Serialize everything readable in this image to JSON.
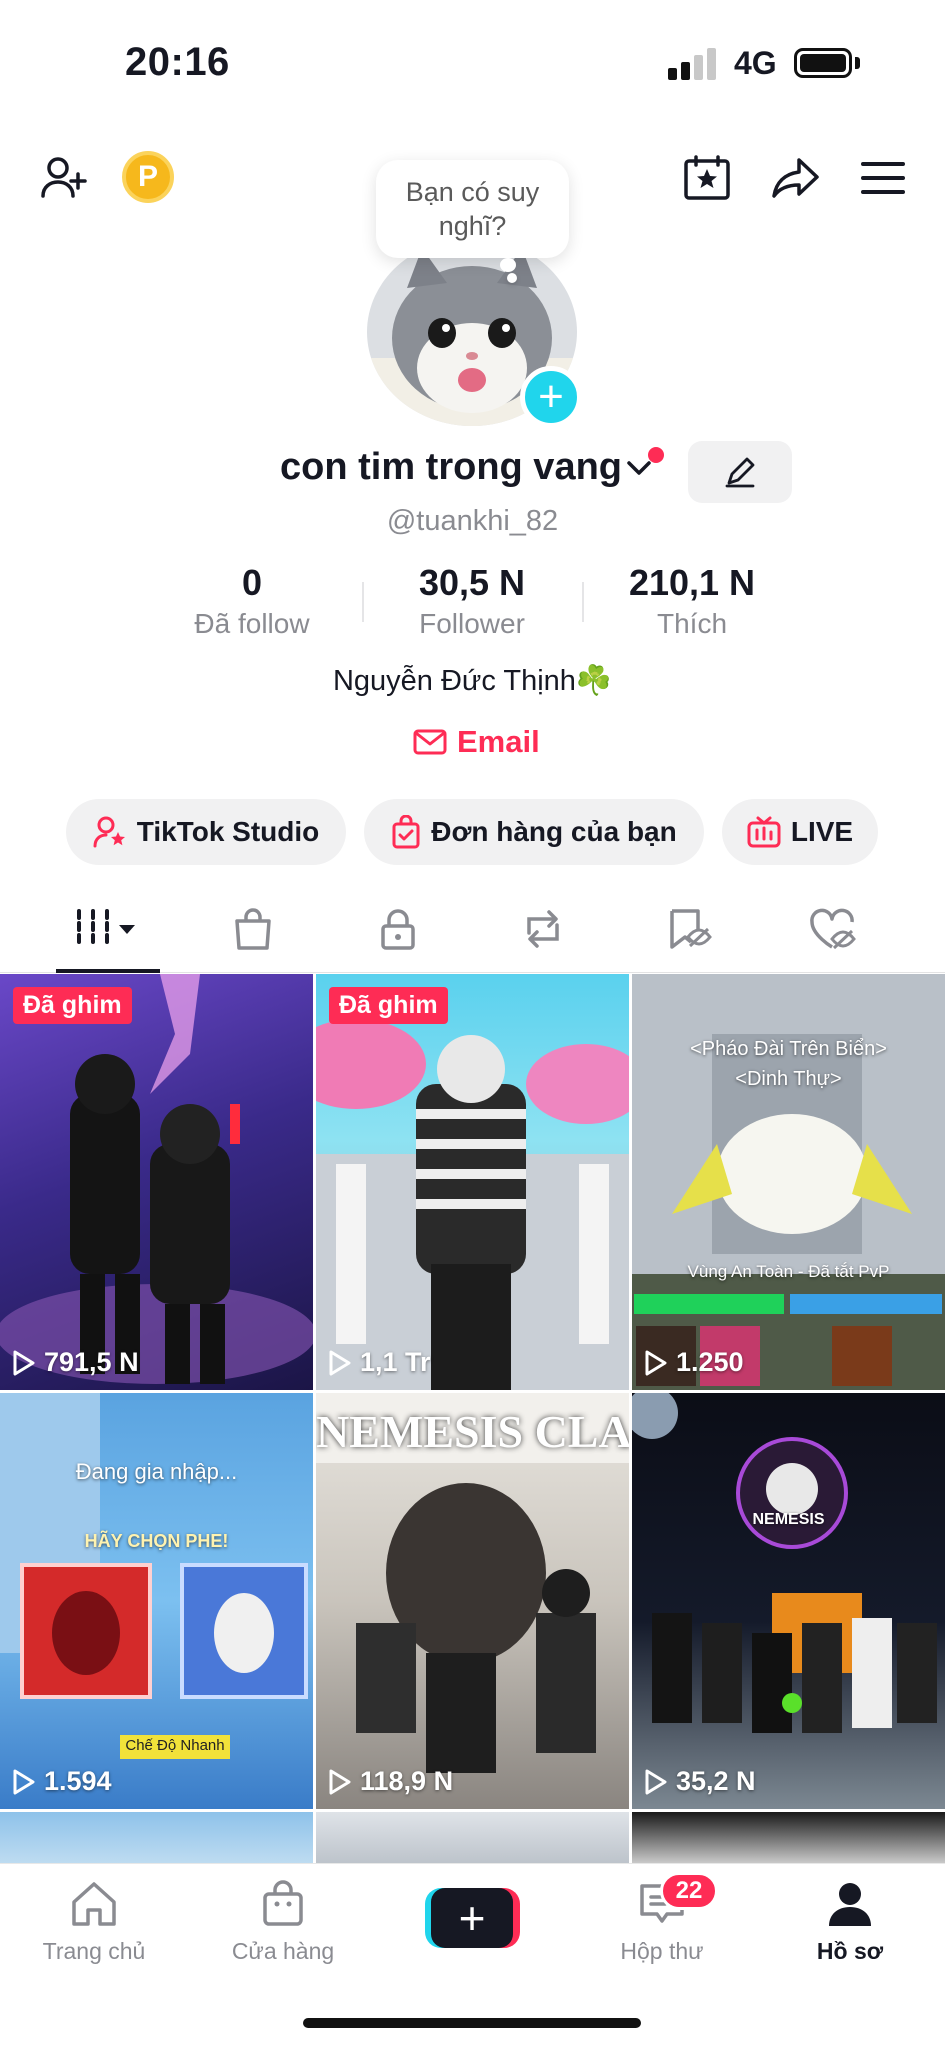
{
  "status_bar": {
    "time": "20:16",
    "network": "4G"
  },
  "top_bar": {
    "coin_letter": "P"
  },
  "profile": {
    "bubble_text": "Bạn có suy nghĩ?",
    "display_name": "con tim trong vang",
    "username": "@tuankhi_82",
    "bio": "Nguyễn Đức Thịnh☘️",
    "email_label": "Email"
  },
  "stats": [
    {
      "value": "0",
      "label": "Đã follow"
    },
    {
      "value": "30,5 N",
      "label": "Follower"
    },
    {
      "value": "210,1 N",
      "label": "Thích"
    }
  ],
  "actions": {
    "studio": "TikTok Studio",
    "orders": "Đơn hàng của bạn",
    "live": "LIVE"
  },
  "videos": [
    {
      "pinned": "Đã ghim",
      "views": "791,5 N"
    },
    {
      "pinned": "Đã ghim",
      "views": "1,1 Tr"
    },
    {
      "views": "1.250",
      "overlay_line1": "<Pháo Đài Trên Biển>",
      "overlay_line2": "<Dinh Thự>",
      "overlay_line3": "Vùng An Toàn - Đã tắt PvP"
    },
    {
      "views": "1.594",
      "overlay_line1": "Đang gia nhập...",
      "overlay_line2": "HÃY CHỌN PHE!",
      "overlay_line3": "Chế Độ Nhanh"
    },
    {
      "views": "118,9 N",
      "overlay_line1": "NEMESIS CLA"
    },
    {
      "views": "35,2 N",
      "overlay_line1": "NEMESIS"
    }
  ],
  "bottom_nav": {
    "home": "Trang chủ",
    "shop": "Cửa hàng",
    "inbox": "Hộp thư",
    "inbox_badge": "22",
    "profile": "Hồ sơ"
  },
  "colors": {
    "accent": "#fe2c55",
    "cyan": "#20d5ec",
    "text": "#161823",
    "muted": "#8a8b91"
  }
}
